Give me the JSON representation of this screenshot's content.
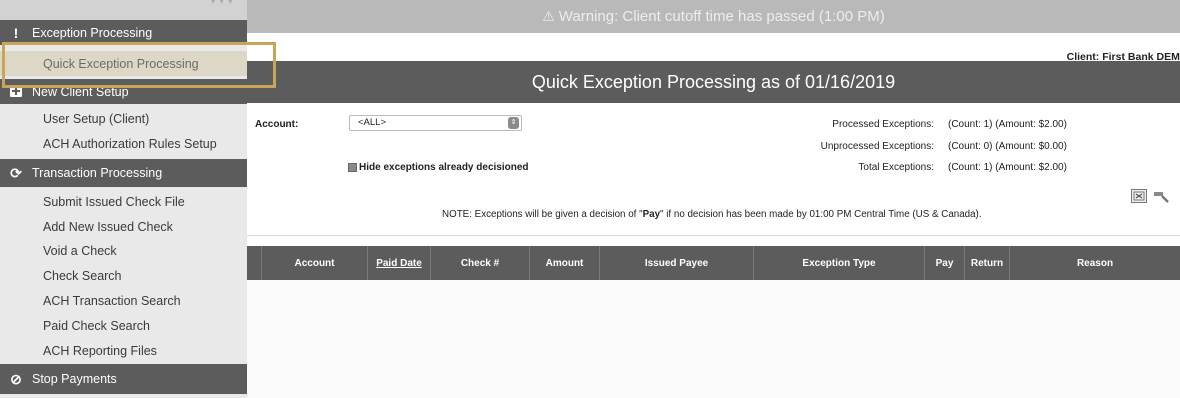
{
  "sidebar": {
    "sections": [
      {
        "label": "Exception Processing",
        "icon": "exclamation-icon"
      },
      {
        "label": "New Client Setup",
        "icon": "plus-icon"
      },
      {
        "label": "Transaction Processing",
        "icon": "refresh-icon"
      },
      {
        "label": "Stop Payments",
        "icon": "no-entry-icon"
      }
    ],
    "items": {
      "quick_exception": "Quick Exception Processing",
      "user_setup": "User Setup (Client)",
      "ach_auth": "ACH Authorization Rules Setup",
      "submit_issued": "Submit Issued Check File",
      "add_issued": "Add New Issued Check",
      "void_check": "Void a Check",
      "check_search": "Check Search",
      "ach_txn_search": "ACH Transaction Search",
      "paid_check_search": "Paid Check Search",
      "ach_reporting": "ACH Reporting Files"
    }
  },
  "warning": "Warning: Client cutoff time has passed (1:00 PM)",
  "client": "Client:  First Bank DEMO",
  "page_title": "Quick Exception Processing as of 01/16/2019",
  "filters": {
    "account_label": "Account:",
    "account_value": "<ALL>",
    "hide_label": "Hide exceptions already decisioned"
  },
  "stats": [
    {
      "label": "Processed Exceptions:",
      "value": "(Count: 1) (Amount: $2.00)"
    },
    {
      "label": "Unprocessed Exceptions:",
      "value": "(Count: 0) (Amount: $0.00)"
    },
    {
      "label": "Total Exceptions:",
      "value": "(Count: 1) (Amount: $2.00)"
    }
  ],
  "note": {
    "prefix": "NOTE: Exceptions will be given a decision of \"",
    "bold": "Pay",
    "suffix": "\" if no decision has been made by 01:00 PM Central Time (US & Canada)."
  },
  "table": {
    "headers": [
      "Account",
      "Paid Date",
      "Check #",
      "Amount",
      "Issued Payee",
      "Exception Type",
      "Pay",
      "Return",
      "Reason"
    ]
  },
  "colors": {
    "sidebar_bg": "#e9e9e9",
    "section_bg": "#5c5c5c",
    "highlight": "#c9a45a",
    "warning_bg": "#b9b9b9"
  }
}
